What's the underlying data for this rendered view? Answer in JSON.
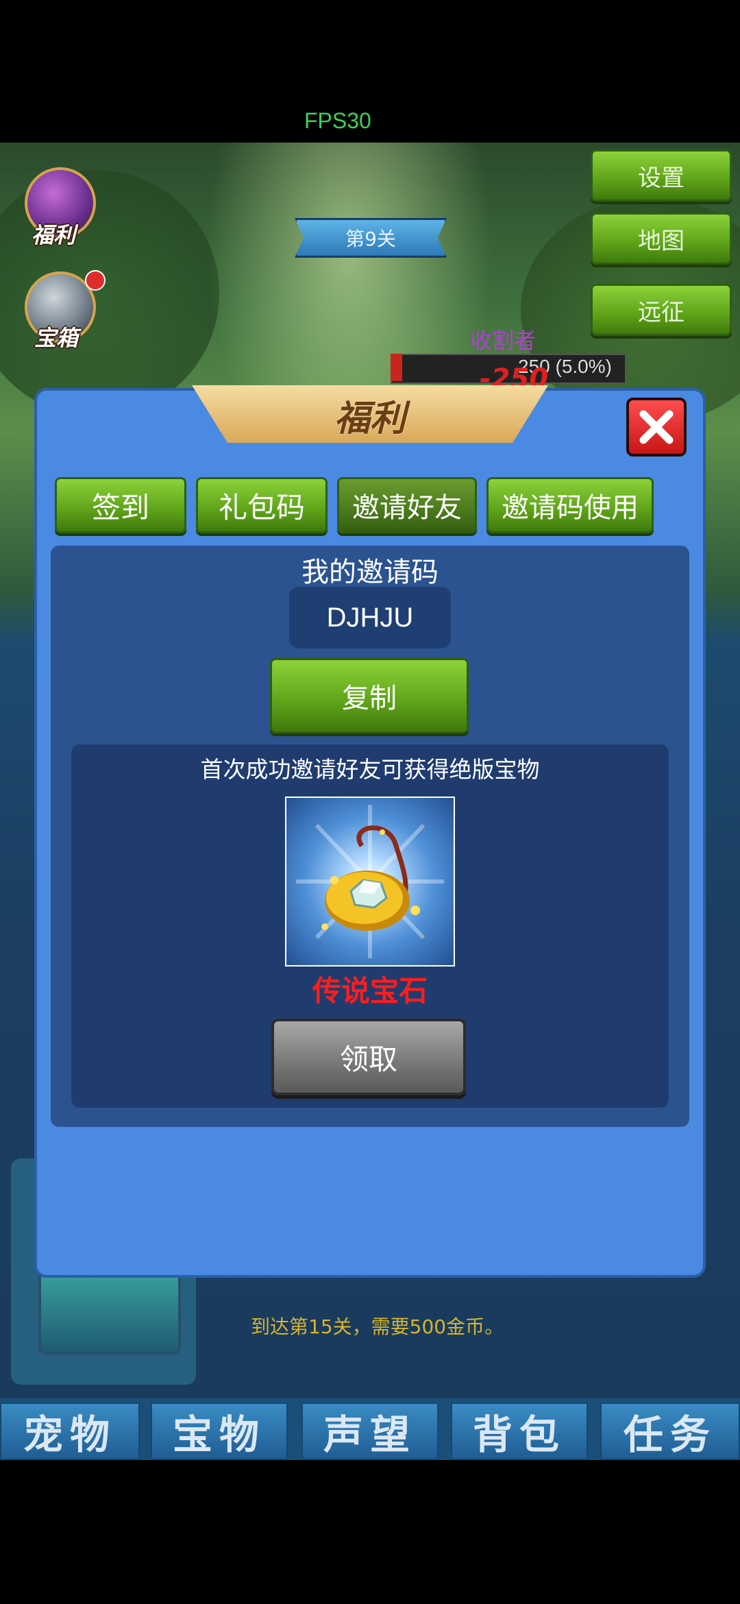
{
  "hud": {
    "fps": "FPS30",
    "level": "第9关",
    "side_buttons": [
      "福利",
      "宝箱"
    ],
    "right_buttons": [
      "设置",
      "地图",
      "远征"
    ],
    "enemy_name": "收割者",
    "enemy_hp": "250 (5.0%)",
    "damage": "-250",
    "requirement": "到达第15关，需要500金币。"
  },
  "dialog": {
    "title": "福利",
    "tabs": [
      "签到",
      "礼包码",
      "邀请好友",
      "邀请码使用"
    ],
    "active_tab": "邀请好友",
    "invite_label": "我的邀请码",
    "invite_code": "DJHJU",
    "copy_label": "复制",
    "reward_text": "首次成功邀请好友可获得绝版宝物",
    "reward_item": "传说宝石",
    "claim_label": "领取"
  },
  "bottom_tabs": [
    "宠物",
    "宝物",
    "声望",
    "背包",
    "任务"
  ],
  "colors": {
    "dialog_bg": "#4b8ae2",
    "green_button": "#6bb61f",
    "reward_name": "#ff1d1d",
    "gray_button": "#777777"
  }
}
